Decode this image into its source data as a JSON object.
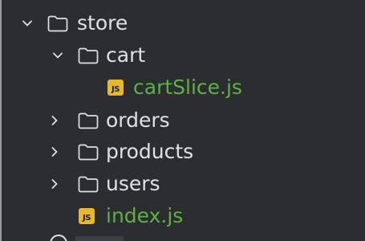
{
  "tree": {
    "store": {
      "label": "store",
      "expanded": true,
      "chevron": "chevron-down-icon",
      "icon": "folder-icon"
    },
    "cart": {
      "label": "cart",
      "expanded": true,
      "chevron": "chevron-down-icon",
      "icon": "folder-icon"
    },
    "cartSlice": {
      "label": "cartSlice.js",
      "icon": "js-file-icon",
      "badge": "JS"
    },
    "orders": {
      "label": "orders",
      "expanded": false,
      "chevron": "chevron-right-icon",
      "icon": "folder-icon"
    },
    "products": {
      "label": "products",
      "expanded": false,
      "chevron": "chevron-right-icon",
      "icon": "folder-icon"
    },
    "users": {
      "label": "users",
      "expanded": false,
      "chevron": "chevron-right-icon",
      "icon": "folder-icon"
    },
    "index": {
      "label": "index.js",
      "icon": "js-file-icon",
      "badge": "JS"
    }
  },
  "colors": {
    "background": "#2b2d30",
    "text": "#dfe1e5",
    "modified_file_text": "#5fb045",
    "js_badge": "#e6b72f"
  }
}
